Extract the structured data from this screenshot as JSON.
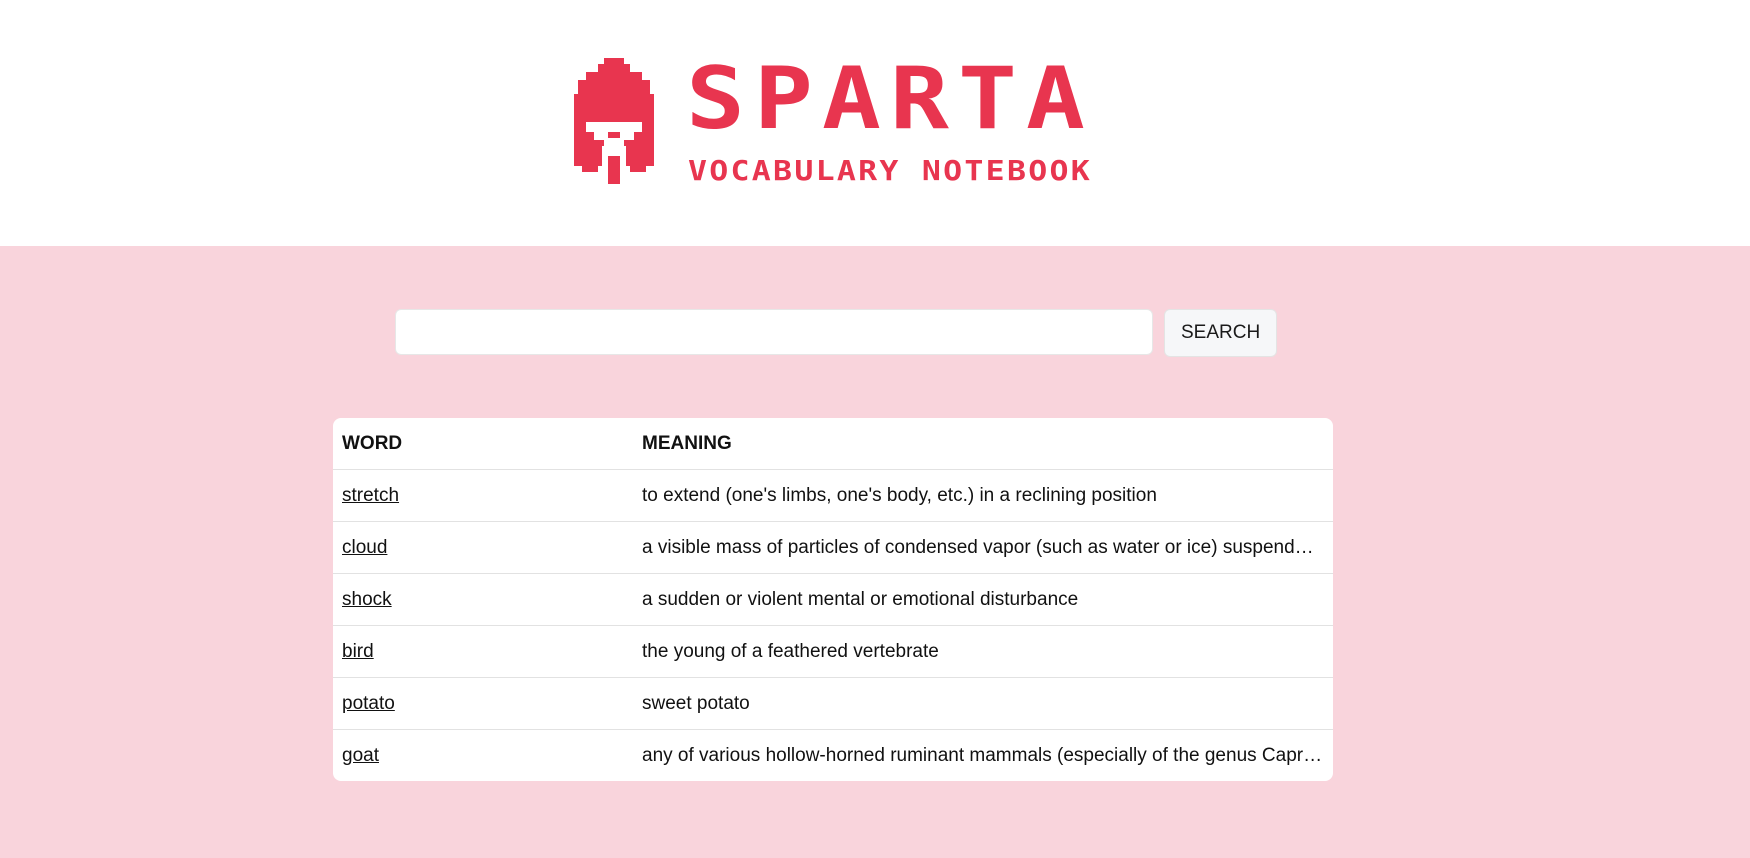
{
  "brand": {
    "logo_icon": "spartan-helmet-icon",
    "title": "SPARTA",
    "subtitle": "VOCABULARY NOTEBOOK",
    "color": "#e8354f"
  },
  "search": {
    "value": "",
    "placeholder": "",
    "button_label": "SEARCH"
  },
  "table": {
    "headers": {
      "word": "WORD",
      "meaning": "MEANING"
    },
    "rows": [
      {
        "word": "stretch",
        "meaning": "to extend (one's limbs, one's body, etc.) in a reclining position"
      },
      {
        "word": "cloud",
        "meaning": "a visible mass of particles of condensed vapor (such as water or ice) suspended in the atmosphere"
      },
      {
        "word": "shock",
        "meaning": "a sudden or violent mental or emotional disturbance"
      },
      {
        "word": "bird",
        "meaning": "the young of a feathered vertebrate"
      },
      {
        "word": "potato",
        "meaning": "sweet potato"
      },
      {
        "word": "goat",
        "meaning": "any of various hollow-horned ruminant mammals (especially of the genus Capra) related to the sheep"
      }
    ]
  },
  "colors": {
    "page_background": "#f9d4dc",
    "header_background": "#ffffff",
    "accent": "#e8354f"
  }
}
